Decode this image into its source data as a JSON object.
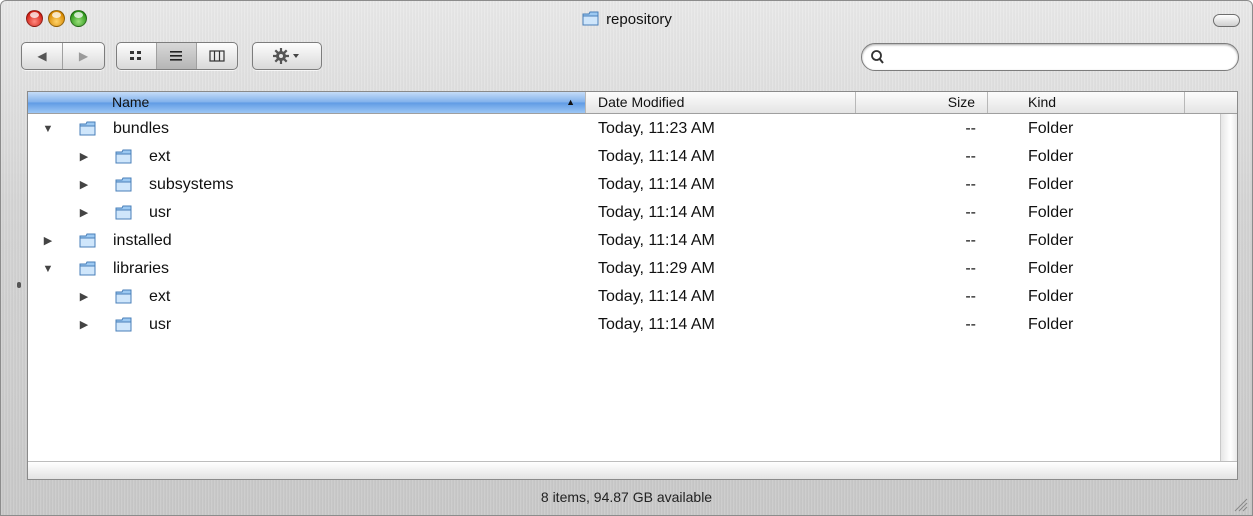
{
  "window": {
    "title": "repository"
  },
  "toolbar": {
    "back_glyph": "◀",
    "forward_glyph": "▶",
    "views": [
      "icon-view",
      "list-view",
      "column-view"
    ],
    "active_view": "list-view",
    "action_icon": "gear-icon",
    "search": {
      "value": "",
      "placeholder": ""
    }
  },
  "columns": {
    "name": "Name",
    "date": "Date Modified",
    "size": "Size",
    "kind": "Kind"
  },
  "rows": [
    {
      "name": "bundles",
      "date": "Today, 11:23 AM",
      "size": "--",
      "kind": "Folder",
      "level": 0,
      "expanded": true
    },
    {
      "name": "ext",
      "date": "Today, 11:14 AM",
      "size": "--",
      "kind": "Folder",
      "level": 1,
      "expanded": false
    },
    {
      "name": "subsystems",
      "date": "Today, 11:14 AM",
      "size": "--",
      "kind": "Folder",
      "level": 1,
      "expanded": false
    },
    {
      "name": "usr",
      "date": "Today, 11:14 AM",
      "size": "--",
      "kind": "Folder",
      "level": 1,
      "expanded": false
    },
    {
      "name": "installed",
      "date": "Today, 11:14 AM",
      "size": "--",
      "kind": "Folder",
      "level": 0,
      "expanded": false
    },
    {
      "name": "libraries",
      "date": "Today, 11:29 AM",
      "size": "--",
      "kind": "Folder",
      "level": 0,
      "expanded": true
    },
    {
      "name": "ext",
      "date": "Today, 11:14 AM",
      "size": "--",
      "kind": "Folder",
      "level": 1,
      "expanded": false
    },
    {
      "name": "usr",
      "date": "Today, 11:14 AM",
      "size": "--",
      "kind": "Folder",
      "level": 1,
      "expanded": false
    }
  ],
  "status": {
    "text": "8 items, 94.87 GB available"
  },
  "colors": {
    "selected_header": "#5f9be4",
    "folder": "#8fc3f0"
  }
}
